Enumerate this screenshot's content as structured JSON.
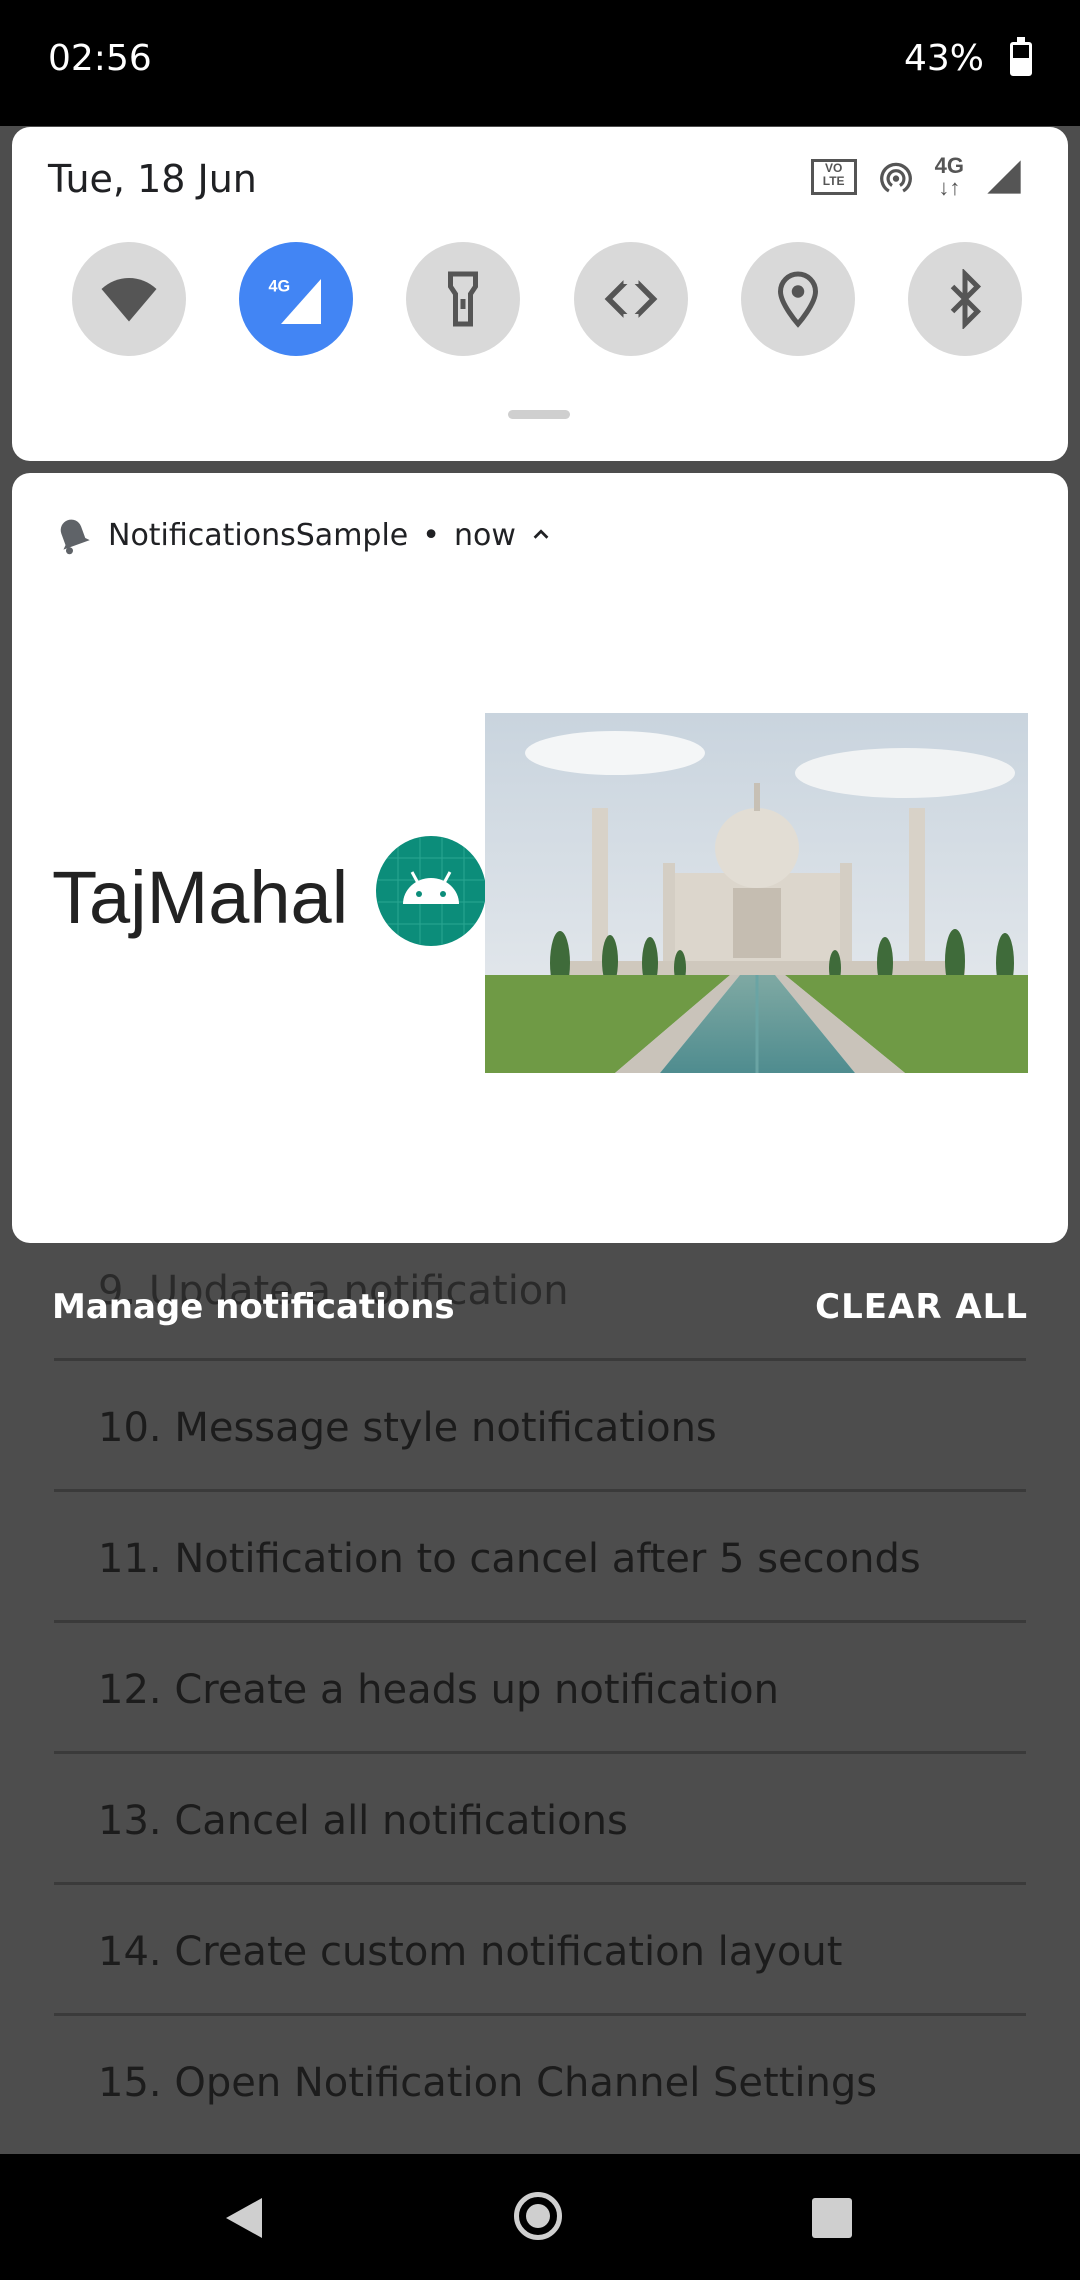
{
  "status_bar": {
    "time": "02:56",
    "battery": "43%"
  },
  "quick_settings": {
    "date": "Tue, 18 Jun",
    "network_label": "4G",
    "volte_label": "VO\nLTE",
    "tiles": [
      {
        "name": "wifi",
        "active": false
      },
      {
        "name": "mobile-data",
        "active": true
      },
      {
        "name": "flashlight",
        "active": false
      },
      {
        "name": "auto-rotate",
        "active": false
      },
      {
        "name": "location",
        "active": false
      },
      {
        "name": "bluetooth",
        "active": false
      }
    ]
  },
  "notification": {
    "app_name": "NotificationsSample",
    "time": "now",
    "title": "TajMahal",
    "image_description": "Taj Mahal"
  },
  "shade_footer": {
    "manage": "Manage notifications",
    "clear_all": "CLEAR ALL"
  },
  "background_list": {
    "partial_item": "9. Update a notification",
    "items": [
      "10. Message style notifications",
      "11. Notification to cancel after 5 seconds",
      "12. Create a heads up notification",
      "13. Cancel all notifications",
      "14. Create custom notification layout",
      "15. Open Notification Channel Settings"
    ]
  },
  "colors": {
    "accent": "#4285f4",
    "tile_bg": "#d9d9d9",
    "app_icon": "#0c8d7a"
  }
}
